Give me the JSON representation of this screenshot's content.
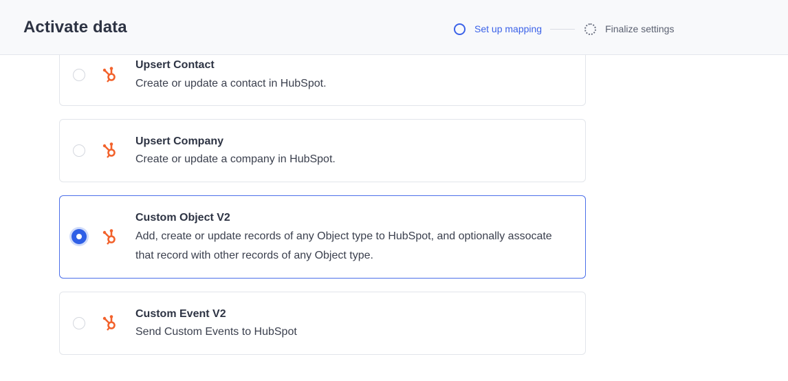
{
  "header": {
    "title": "Activate data",
    "steps": [
      {
        "label": "Set up mapping",
        "state": "active"
      },
      {
        "label": "Finalize settings",
        "state": "pending"
      }
    ]
  },
  "colors": {
    "accent": "#3b62e8",
    "hubspot_orange": "#f2622c",
    "selected_border": "#4a6ee9"
  },
  "actions": [
    {
      "title": "Upsert Contact",
      "description": "Create or update a contact in HubSpot.",
      "selected": false,
      "icon": "hubspot-logo-icon"
    },
    {
      "title": "Upsert Company",
      "description": "Create or update a company in HubSpot.",
      "selected": false,
      "icon": "hubspot-logo-icon"
    },
    {
      "title": "Custom Object V2",
      "description": "Add, create or update records of any Object type to HubSpot, and optionally assocate that record with other records of any Object type.",
      "selected": true,
      "icon": "hubspot-logo-icon"
    },
    {
      "title": "Custom Event V2",
      "description": "Send Custom Events to HubSpot",
      "selected": false,
      "icon": "hubspot-logo-icon"
    }
  ]
}
